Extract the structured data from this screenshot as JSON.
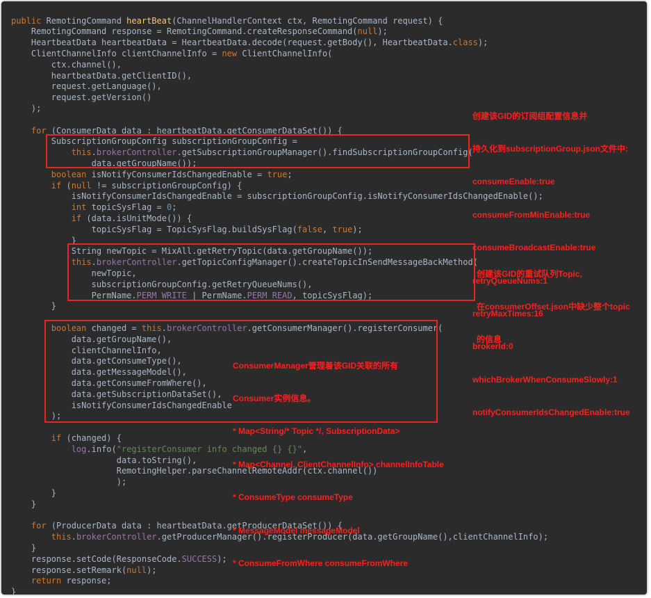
{
  "colors": {
    "background": "#2b2b2b",
    "text": "#a9b7c6",
    "keyword": "#cc7832",
    "method_declaration": "#ffc66d",
    "string": "#6a8759",
    "number": "#6897bb",
    "field": "#9876aa",
    "annotation": "#ff1f1f"
  },
  "code_lines": [
    [
      [
        "kw",
        "public "
      ],
      [
        "t",
        "RemotingCommand "
      ],
      [
        "fn",
        "heartBeat"
      ],
      [
        "t",
        "(ChannelHandlerContext ctx, RemotingCommand request) {"
      ]
    ],
    [
      [
        "t",
        "    RemotingCommand response = RemotingCommand.createResponseCommand("
      ],
      [
        "kw",
        "null"
      ],
      [
        "t",
        ");"
      ]
    ],
    [
      [
        "t",
        "    HeartbeatData heartbeatData = HeartbeatData.decode(request.getBody(), HeartbeatData."
      ],
      [
        "kw",
        "class"
      ],
      [
        "t",
        ");"
      ]
    ],
    [
      [
        "t",
        "    ClientChannelInfo clientChannelInfo = "
      ],
      [
        "kw",
        "new "
      ],
      [
        "t",
        "ClientChannelInfo("
      ]
    ],
    [
      [
        "t",
        "        ctx.channel(),"
      ]
    ],
    [
      [
        "t",
        "        heartbeatData.getClientID(),"
      ]
    ],
    [
      [
        "t",
        "        request.getLanguage(),"
      ]
    ],
    [
      [
        "t",
        "        request.getVersion()"
      ]
    ],
    [
      [
        "t",
        "    );"
      ]
    ],
    [
      [
        "t",
        ""
      ]
    ],
    [
      [
        "t",
        "    "
      ],
      [
        "kw",
        "for "
      ],
      [
        "t",
        "(ConsumerData data : heartbeatData.getConsumerDataSet()) {"
      ]
    ],
    [
      [
        "t",
        "        SubscriptionGroupConfig subscriptionGroupConfig ="
      ]
    ],
    [
      [
        "t",
        "            "
      ],
      [
        "kw",
        "this"
      ],
      [
        "t",
        "."
      ],
      [
        "fld",
        "brokerController"
      ],
      [
        "t",
        ".getSubscriptionGroupManager().findSubscriptionGroupConfig("
      ]
    ],
    [
      [
        "t",
        "                data.getGroupName());"
      ]
    ],
    [
      [
        "t",
        "        "
      ],
      [
        "kw",
        "boolean "
      ],
      [
        "t",
        "isNotifyConsumerIdsChangedEnable = "
      ],
      [
        "kw",
        "true"
      ],
      [
        "t",
        ";"
      ]
    ],
    [
      [
        "t",
        "        "
      ],
      [
        "kw",
        "if "
      ],
      [
        "t",
        "("
      ],
      [
        "kw",
        "null "
      ],
      [
        "t",
        "!= subscriptionGroupConfig) {"
      ]
    ],
    [
      [
        "t",
        "            isNotifyConsumerIdsChangedEnable = subscriptionGroupConfig.isNotifyConsumerIdsChangedEnable();"
      ]
    ],
    [
      [
        "t",
        "            "
      ],
      [
        "kw",
        "int "
      ],
      [
        "t",
        "topicSysFlag = "
      ],
      [
        "num",
        "0"
      ],
      [
        "t",
        ";"
      ]
    ],
    [
      [
        "t",
        "            "
      ],
      [
        "kw",
        "if "
      ],
      [
        "t",
        "(data.isUnitMode()) {"
      ]
    ],
    [
      [
        "t",
        "                topicSysFlag = TopicSysFlag.buildSysFlag("
      ],
      [
        "kw",
        "false"
      ],
      [
        "t",
        ", "
      ],
      [
        "kw",
        "true"
      ],
      [
        "t",
        ");"
      ]
    ],
    [
      [
        "t",
        "            }"
      ]
    ],
    [
      [
        "t",
        "            String newTopic = MixAll.getRetryTopic(data.getGroupName());"
      ]
    ],
    [
      [
        "t",
        "            "
      ],
      [
        "kw",
        "this"
      ],
      [
        "t",
        "."
      ],
      [
        "fld",
        "brokerController"
      ],
      [
        "t",
        ".getTopicConfigManager().createTopicInSendMessageBackMethod("
      ]
    ],
    [
      [
        "t",
        "                newTopic,"
      ]
    ],
    [
      [
        "t",
        "                subscriptionGroupConfig.getRetryQueueNums(),"
      ]
    ],
    [
      [
        "t",
        "                PermName."
      ],
      [
        "fld",
        "PERM_WRITE "
      ],
      [
        "t",
        "| PermName."
      ],
      [
        "fld",
        "PERM_READ"
      ],
      [
        "t",
        ", topicSysFlag);"
      ]
    ],
    [
      [
        "t",
        "        }"
      ]
    ],
    [
      [
        "t",
        ""
      ]
    ],
    [
      [
        "t",
        "        "
      ],
      [
        "kw",
        "boolean "
      ],
      [
        "t",
        "changed = "
      ],
      [
        "kw",
        "this"
      ],
      [
        "t",
        "."
      ],
      [
        "fld",
        "brokerController"
      ],
      [
        "t",
        ".getConsumerManager().registerConsumer("
      ]
    ],
    [
      [
        "t",
        "            data.getGroupName(),"
      ]
    ],
    [
      [
        "t",
        "            clientChannelInfo,"
      ]
    ],
    [
      [
        "t",
        "            data.getConsumeType(),"
      ]
    ],
    [
      [
        "t",
        "            data.getMessageModel(),"
      ]
    ],
    [
      [
        "t",
        "            data.getConsumeFromWhere(),"
      ]
    ],
    [
      [
        "t",
        "            data.getSubscriptionDataSet(),"
      ]
    ],
    [
      [
        "t",
        "            isNotifyConsumerIdsChangedEnable"
      ]
    ],
    [
      [
        "t",
        "        );"
      ]
    ],
    [
      [
        "t",
        ""
      ]
    ],
    [
      [
        "t",
        "        "
      ],
      [
        "kw",
        "if "
      ],
      [
        "t",
        "(changed) {"
      ]
    ],
    [
      [
        "t",
        "            "
      ],
      [
        "fld",
        "log"
      ],
      [
        "t",
        ".info("
      ],
      [
        "str",
        "\"registerConsumer info changed {} {}\""
      ],
      [
        "t",
        ","
      ]
    ],
    [
      [
        "t",
        "                     data.toString(),"
      ]
    ],
    [
      [
        "t",
        "                     RemotingHelper.parseChannelRemoteAddr(ctx.channel())"
      ]
    ],
    [
      [
        "t",
        "                     );"
      ]
    ],
    [
      [
        "t",
        "        }"
      ]
    ],
    [
      [
        "t",
        "    }"
      ]
    ],
    [
      [
        "t",
        ""
      ]
    ],
    [
      [
        "t",
        "    "
      ],
      [
        "kw",
        "for "
      ],
      [
        "t",
        "(ProducerData data : heartbeatData.getProducerDataSet()) {"
      ]
    ],
    [
      [
        "t",
        "        "
      ],
      [
        "kw",
        "this"
      ],
      [
        "t",
        "."
      ],
      [
        "fld",
        "brokerController"
      ],
      [
        "t",
        ".getProducerManager().registerProducer(data.getGroupName(),clientChannelInfo);"
      ]
    ],
    [
      [
        "t",
        "    }"
      ]
    ],
    [
      [
        "t",
        "    response.setCode(ResponseCode."
      ],
      [
        "fld",
        "SUCCESS"
      ],
      [
        "t",
        ");"
      ]
    ],
    [
      [
        "t",
        "    response.setRemark("
      ],
      [
        "kw",
        "null"
      ],
      [
        "t",
        ");"
      ]
    ],
    [
      [
        "t",
        "    "
      ],
      [
        "kw",
        "return "
      ],
      [
        "t",
        "response;"
      ]
    ],
    [
      [
        "t",
        "}"
      ]
    ]
  ],
  "annotations": [
    {
      "lines": [
        "创建该GID的订阅组配置信息并",
        "持久化到subscriptionGroup.json文件中:",
        "consumeEnable:true",
        "consumeFromMinEnable:true",
        "consumeBroadcastEnable:true",
        "retryQueueNums:1",
        "retryMaxTimes:16",
        "brokerId:0",
        "whichBrokerWhenConsumeSlowly:1",
        "notifyConsumerIdsChangedEnable:true"
      ]
    },
    {
      "lines": [
        "创建该GID的重试队列Topic,",
        "在consumerOffset.json中缺少整个topic",
        "的信息"
      ]
    },
    {
      "lines": [
        "ConsumerManager管理着该GID关联的所有",
        "Consumer实例信息。",
        "* Map<String/* Topic */, SubscriptionData>",
        "* Map<Channel, ClientChannelInfo> channelInfoTable",
        "* ConsumeType consumeType",
        "* MessageModel messageModel",
        "* ConsumeFromWhere consumeFromWhere"
      ]
    }
  ]
}
